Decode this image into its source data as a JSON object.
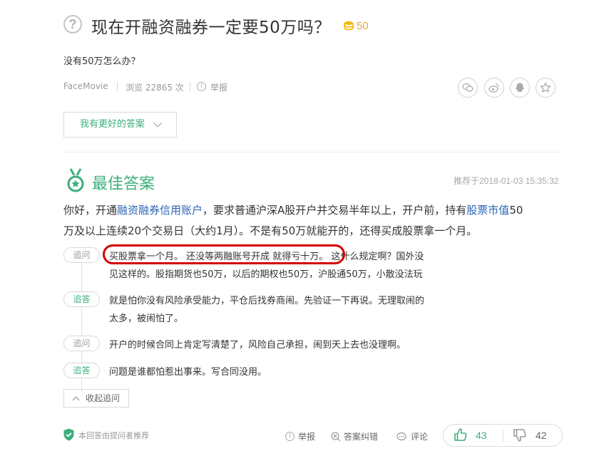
{
  "question": {
    "title": "现在开融资融券一定要50万吗？",
    "coin_value": "50",
    "description": "没有50万怎么办？",
    "author": "FaceMovie",
    "views": "浏览 22865 次",
    "report_label": "举报"
  },
  "share": {
    "icons": [
      "wechat-icon",
      "weibo-icon",
      "qq-icon",
      "favorite-star-icon"
    ]
  },
  "better_answer_button": "我有更好的答案",
  "best_answer": {
    "title": "最佳答案",
    "recommended_time": "推荐于2018-01-03 15:35:32",
    "line1": {
      "p1": "你好，开通",
      "link1": "融资融券信用账户",
      "p2": "，要求普通沪深A股开户并交易半年以上，开户前，持有",
      "link2": "股票市值",
      "p3": "50"
    },
    "line2": "万及以上连续20个交易日（大约1月）。不是有50万就能开的，还得买成股票拿一个月。"
  },
  "thread": [
    {
      "tag": "追问",
      "lines": [
        "买股票拿一个月。 还没等两融账号开成 就得亏十万。 这什么规定啊？国外没",
        "见这样的。股指期货也50万，以后的期权也50万，沪股通50万，小散没法玩"
      ]
    },
    {
      "tag": "追答",
      "lines": [
        "就是怕你没有风险承受能力，平仓后找券商闹。先验证一下再说。无理取闹的",
        "太多，被闹怕了。"
      ]
    },
    {
      "tag": "追问",
      "lines": [
        "开户的时候合同上肯定写清楚了，风险自己承担，闹到天上去也没理啊。"
      ]
    },
    {
      "tag": "追答",
      "lines": [
        "问题是谁都怕惹出事来。写合同没用。"
      ]
    }
  ],
  "collapse_label": "收起追问",
  "footer": {
    "note": "本回答由提问者推荐",
    "report": "举报",
    "correct": "答案纠错",
    "comment": "评论",
    "likes": "43",
    "dislikes": "42"
  },
  "colors": {
    "accent_green": "#3eaf7c",
    "link_blue": "#2d64b3",
    "coin_orange": "#e6a23c",
    "annotation_red": "#d40000"
  }
}
